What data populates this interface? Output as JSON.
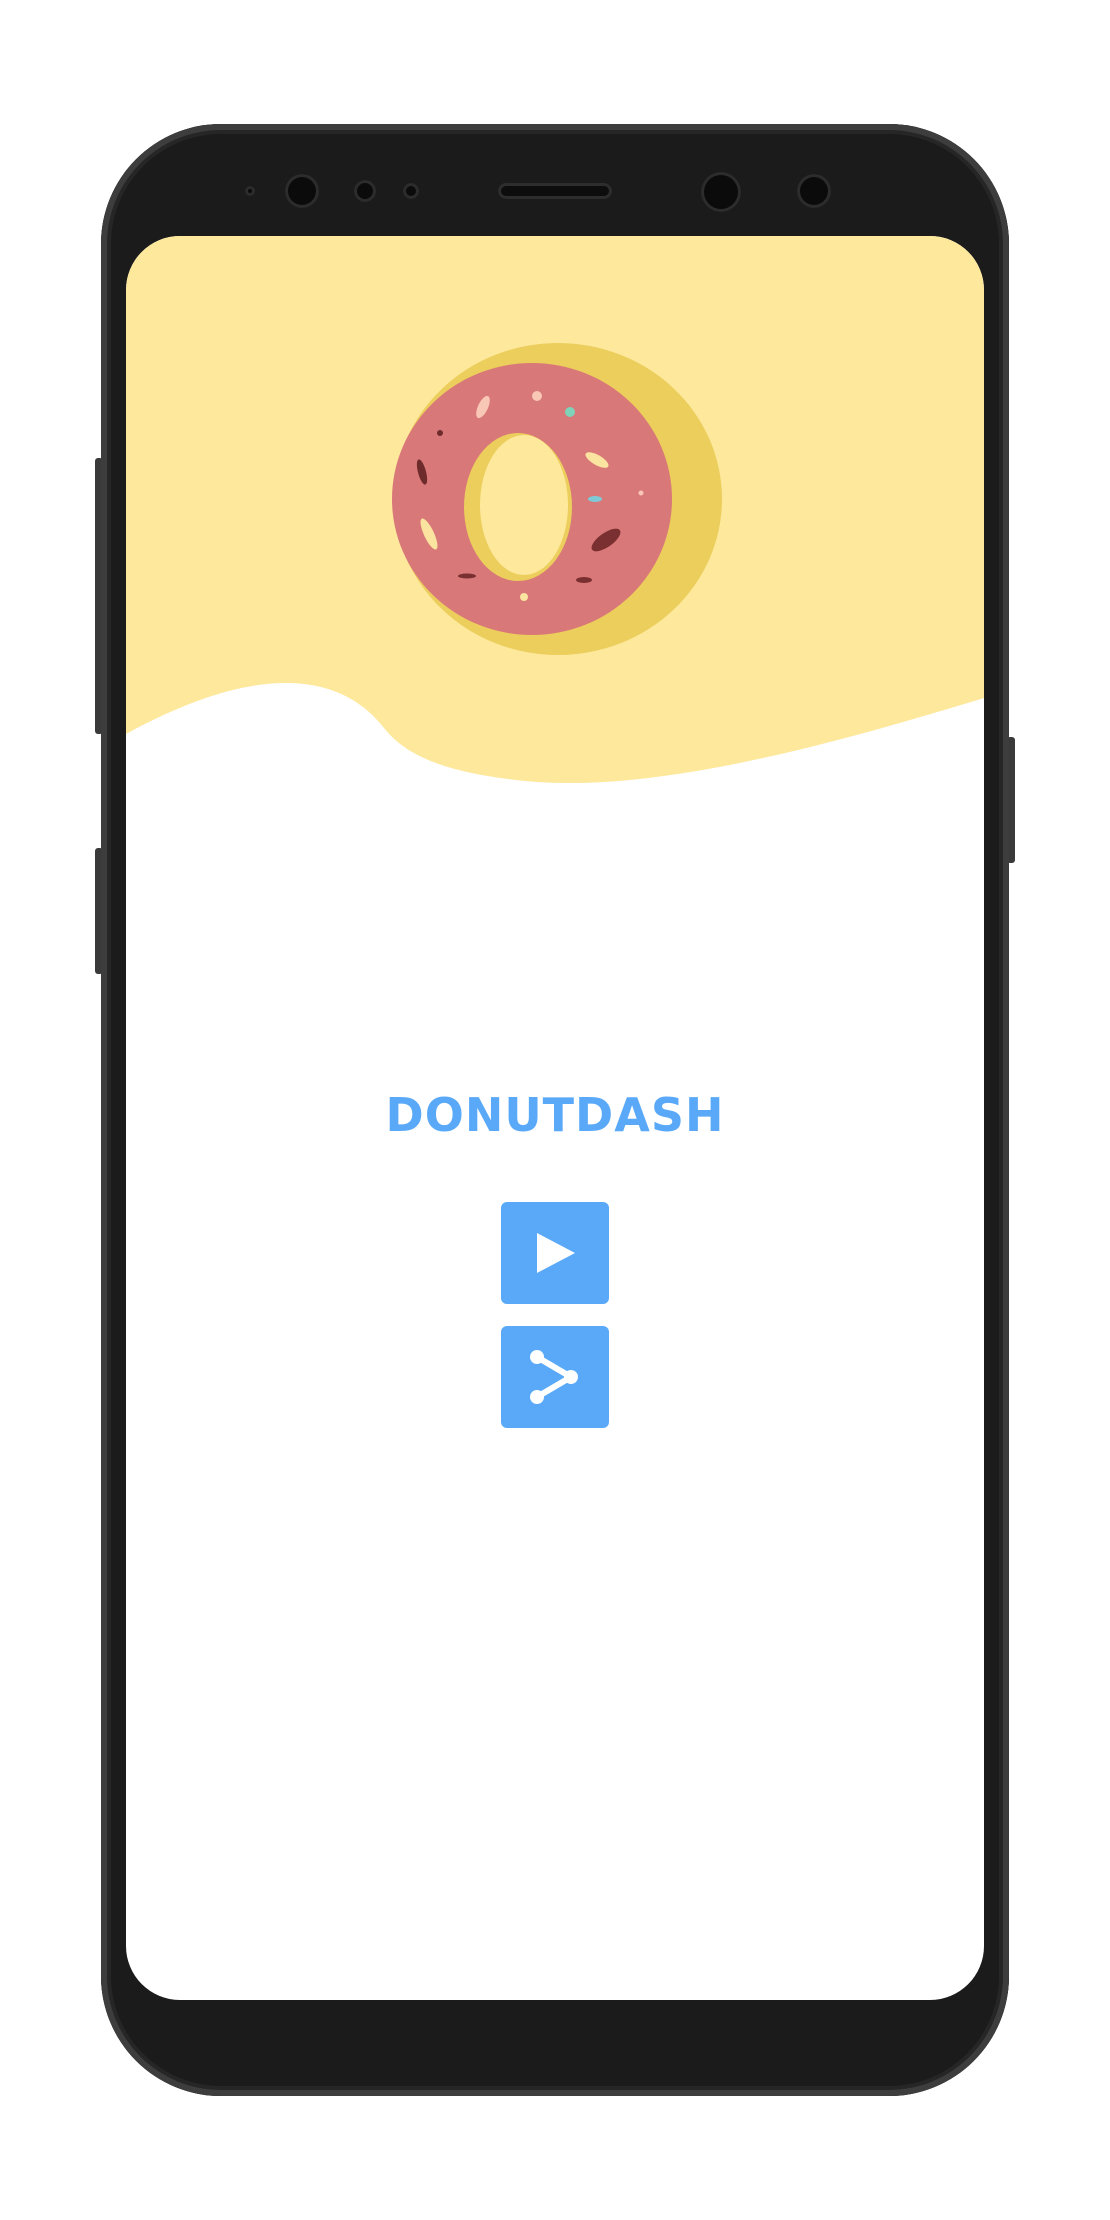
{
  "app": {
    "title": "DONUTDASH"
  },
  "menu": {
    "buttons": [
      {
        "id": "play",
        "icon": "play-icon"
      },
      {
        "id": "share",
        "icon": "share-icon"
      }
    ]
  },
  "colors": {
    "accent": "#5aa9f8",
    "header_background": "#fde89c",
    "donut_base": "#ecce5c",
    "donut_frosting": "#d97878",
    "device_frame": "#1b1b1b",
    "screen_background": "#ffffff"
  }
}
